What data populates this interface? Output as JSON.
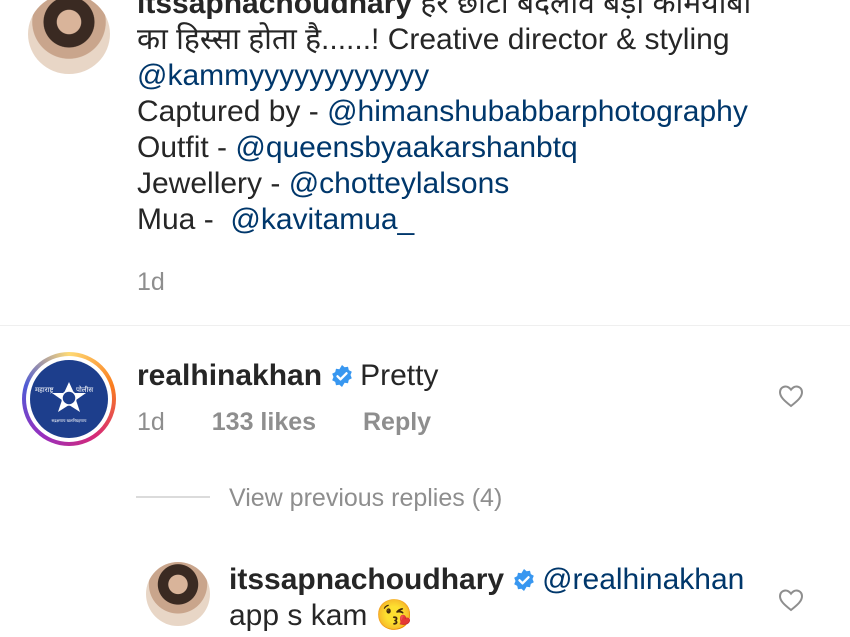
{
  "post_caption": {
    "username": "itssapnachoudhary",
    "text_line1": "हर छोटा बदलाव बड़ी कामयाबी",
    "text_line2": "का हिस्सा होता है......! Creative director & styling",
    "mention_director": "@kammyyyyyyyyyyyy",
    "captured_label": "Captured by - ",
    "captured_mention": "@himanshubabbarphotography",
    "outfit_label": "Outfit - ",
    "outfit_mention": "@queensbyaakarshanbtq",
    "jewellery_label": "Jewellery - ",
    "jewellery_mention": "@chotteylalsons",
    "mua_label": "Mua - ",
    "mua_mention": "@kavitamua_",
    "time": "1d"
  },
  "comment": {
    "username": "realhinakhan",
    "text": "Pretty",
    "time": "1d",
    "likes": "133 likes",
    "reply_label": "Reply",
    "avatar_text_left": "महाराष्ट्र",
    "avatar_text_right": "पोलीस",
    "avatar_text_bottom": "सद्रक्षणाय खलनिग्रहणाय"
  },
  "view_replies": "View previous replies (4)",
  "reply": {
    "username": "itssapnachoudhary",
    "mention": "@realhinakhan",
    "text": "app s kam",
    "emoji": "😘"
  },
  "colors": {
    "verified_blue": "#3897f0",
    "mention_blue": "#00376b",
    "meta_gray": "#8e8e8e"
  }
}
